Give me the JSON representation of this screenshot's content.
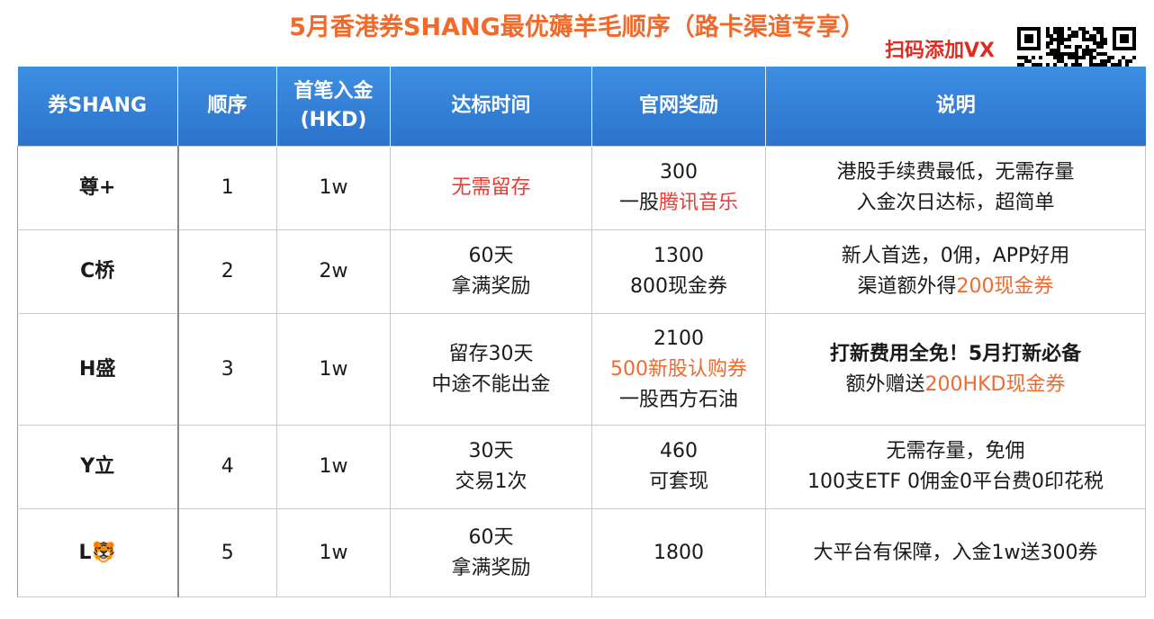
{
  "title": "5月香港券SHANG最优薅羊毛顺序（路卡渠道专享）",
  "scan_label": "扫码添加VX",
  "qr_icon": "qr-code-with-wechat-logo",
  "colors": {
    "title": "#f06a2b",
    "scan_label": "#e02b20",
    "header_bg": "#2f7fd8",
    "highlight_red": "#ec3b33",
    "highlight_orange": "#ee6a2f"
  },
  "headers": {
    "broker": "券SHANG",
    "order": "顺序",
    "deposit_line1": "首笔入金",
    "deposit_line2": "(HKD)",
    "period": "达标时间",
    "reward": "官网奖励",
    "note": "说明"
  },
  "rows": [
    {
      "broker": "尊+",
      "order": "1",
      "deposit": "1w",
      "period": [
        "无需留存"
      ],
      "reward_l1": "300",
      "reward_l2a": "一股",
      "reward_l2b": "腾讯音乐",
      "note_l1": "港股手续费最低，无需存量",
      "note_l2": "入金次日达标，超简单"
    },
    {
      "broker": "C桥",
      "order": "2",
      "deposit": "2w",
      "period": [
        "60天",
        "拿满奖励"
      ],
      "reward_l1": "1300",
      "reward_l2": "800现金券",
      "note_l1": "新人首选，0佣，APP好用",
      "note_l2a": "渠道额外得",
      "note_l2b": "200现金券"
    },
    {
      "broker": "H盛",
      "order": "3",
      "deposit": "1w",
      "period": [
        "留存30天",
        "中途不能出金"
      ],
      "reward_l1": "2100",
      "reward_l2": "500新股认购券",
      "reward_l3": "一股西方石油",
      "note_l1": "打新费用全免！5月打新必备",
      "note_l2a": "额外赠送",
      "note_l2b": "200HKD现金券"
    },
    {
      "broker": "Y立",
      "order": "4",
      "deposit": "1w",
      "period": [
        "30天",
        "交易1次"
      ],
      "reward_l1": "460",
      "reward_l2": "可套现",
      "note_l1": "无需存量，免佣",
      "note_l2": "100支ETF 0佣金0平台费0印花税"
    },
    {
      "broker": "L🐯",
      "order": "5",
      "deposit": "1w",
      "period": [
        "60天",
        "拿满奖励"
      ],
      "reward_l1": "1800",
      "note_l1": "大平台有保障，入金1w送300券"
    }
  ]
}
